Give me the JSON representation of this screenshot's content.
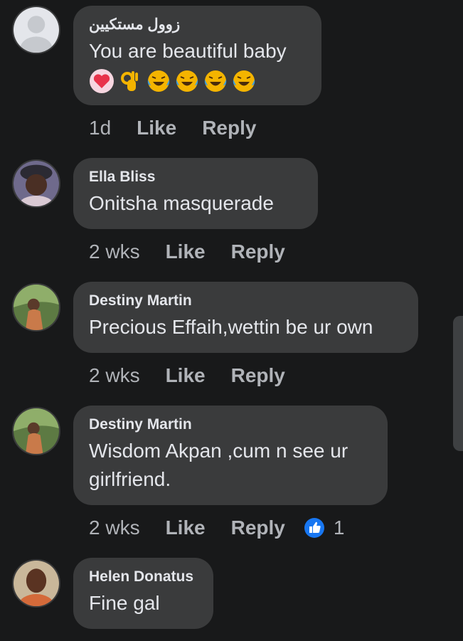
{
  "comments": [
    {
      "name": "زوول مستكيين",
      "text": "You are beautiful baby",
      "emojis": [
        "heart-icon",
        "ok-hand-icon",
        "laughing-tears-icon",
        "laughing-tears-icon",
        "laughing-tears-icon",
        "laughing-tears-icon"
      ],
      "time": "1d",
      "like": "Like",
      "reply": "Reply"
    },
    {
      "name": "Ella Bliss",
      "text": "Onitsha  masquerade",
      "time": "2 wks",
      "like": "Like",
      "reply": "Reply"
    },
    {
      "name": "Destiny Martin",
      "text": "Precious Effaih,wettin be ur own",
      "time": "2 wks",
      "like": "Like",
      "reply": "Reply"
    },
    {
      "name": "Destiny Martin",
      "text_line1": "Wisdom Akpan ,cum n see ur",
      "text_line2": "girlfriend.",
      "time": "2 wks",
      "like": "Like",
      "reply": "Reply",
      "reaction_count": "1"
    },
    {
      "name": "Helen Donatus",
      "text": "Fine gal"
    }
  ],
  "colors": {
    "background": "#18191a",
    "bubble": "#3a3b3c",
    "text": "#e4e6eb",
    "secondary": "#b0b3b8",
    "like_blue": "#1877f2"
  }
}
